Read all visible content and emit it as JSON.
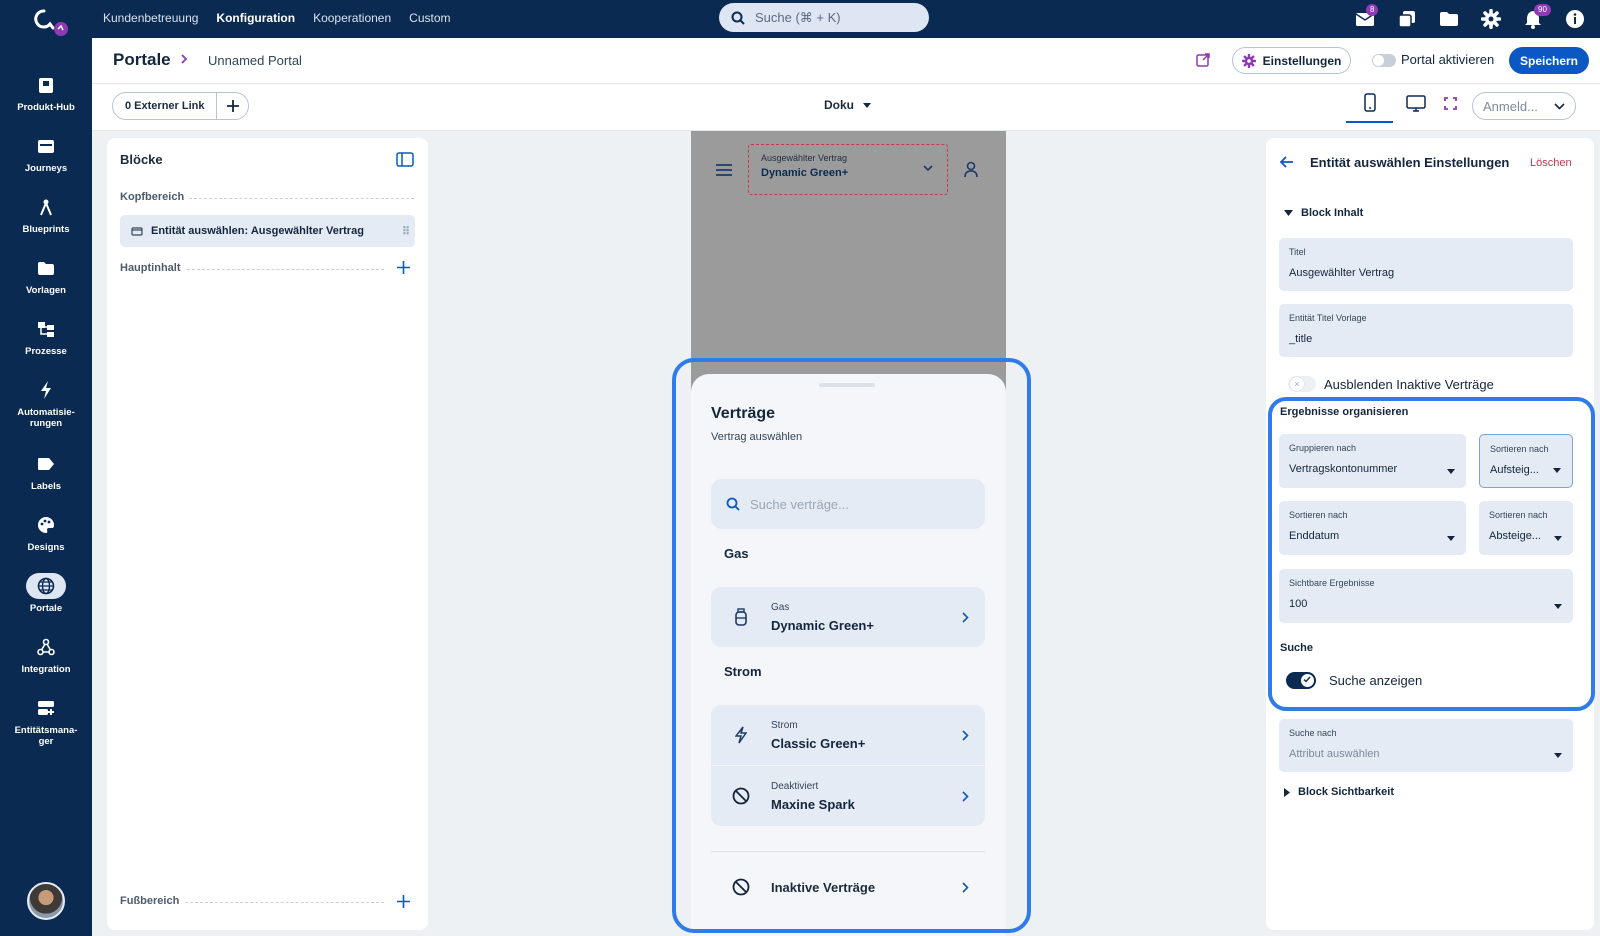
{
  "topbar": {
    "nav": [
      "Kundenbetreuung",
      "Konfiguration",
      "Kooperationen",
      "Custom"
    ],
    "active_nav": "Konfiguration",
    "search_placeholder": "Suche (⌘ + K)",
    "mail_badge": "8",
    "notification_badge": "90",
    "icons": [
      "mail-icon",
      "copy-icon",
      "folder-icon",
      "gear-icon",
      "bell-icon",
      "info-icon"
    ]
  },
  "sidebar": {
    "items": [
      {
        "label": "Produkt-Hub",
        "icon": "product-hub-icon"
      },
      {
        "label": "Journeys",
        "icon": "journeys-icon"
      },
      {
        "label": "Blueprints",
        "icon": "blueprints-icon"
      },
      {
        "label": "Vorlagen",
        "icon": "folder-icon"
      },
      {
        "label": "Prozesse",
        "icon": "processes-icon"
      },
      {
        "label": "Automatisie-\nrungen",
        "icon": "lightning-icon"
      },
      {
        "label": "Labels",
        "icon": "label-icon"
      },
      {
        "label": "Designs",
        "icon": "palette-icon"
      },
      {
        "label": "Portale",
        "icon": "globe-icon"
      },
      {
        "label": "Integration",
        "icon": "webhook-icon"
      },
      {
        "label": "Entitätsmana-\nger",
        "icon": "entity-manager-icon"
      }
    ],
    "active": "Portale"
  },
  "header": {
    "crumb_root": "Portale",
    "crumb_current": "Unnamed Portal",
    "settings_label": "Einstellungen",
    "activate_label": "Portal aktivieren",
    "save_label": "Speichern"
  },
  "toolbar": {
    "external_link_label": "0 Externer Link",
    "doku_label": "Doku",
    "login_select": "Anmeld..."
  },
  "blocks_panel": {
    "title": "Blöcke",
    "sections": {
      "head": "Kopfbereich",
      "main": "Hauptinhalt",
      "footer": "Fußbereich"
    },
    "head_item": "Entität auswählen: Ausgewählter Vertrag"
  },
  "preview": {
    "selector_title": "Ausgewählter Vertrag",
    "selector_value": "Dynamic Green+",
    "sheet_title": "Verträge",
    "sheet_subtitle": "Vertrag auswählen",
    "search_placeholder": "Suche verträge...",
    "groups": [
      {
        "title": "Gas",
        "items": [
          {
            "type": "Gas",
            "name": "Dynamic Green+",
            "icon": "gas-cylinder-icon"
          }
        ]
      },
      {
        "title": "Strom",
        "items": [
          {
            "type": "Strom",
            "name": "Classic Green+",
            "icon": "lightning-icon"
          },
          {
            "type": "Deaktiviert",
            "name": "Maxine Spark",
            "icon": "blocked-icon"
          }
        ]
      }
    ],
    "inactive_label": "Inaktive Verträge"
  },
  "settings_panel": {
    "title": "Entität auswählen Einstellungen",
    "delete_label": "Löschen",
    "block_content": "Block Inhalt",
    "title_field": {
      "label": "Titel",
      "value": "Ausgewählter Vertrag"
    },
    "template_field": {
      "label": "Entität Titel Vorlage",
      "value": "_title"
    },
    "hide_inactive_label": "Ausblenden Inaktive Verträge",
    "hide_inactive_on": false,
    "organize_title": "Ergebnisse organisieren",
    "group_by": {
      "label": "Gruppieren nach",
      "value": "Vertragskontonummer"
    },
    "sort1": {
      "label": "Sortieren nach",
      "value": "Aufsteig..."
    },
    "sort2": {
      "label": "Sortieren nach",
      "value": "Enddatum"
    },
    "sort2_dir": {
      "label": "Sortieren nach",
      "value": "Absteige..."
    },
    "visible_results": {
      "label": "Sichtbare Ergebnisse",
      "value": "100"
    },
    "search_section": "Suche",
    "show_search_label": "Suche anzeigen",
    "show_search_on": true,
    "search_by": {
      "label": "Suche nach",
      "placeholder": "Attribut auswählen"
    },
    "block_visibility": "Block Sichtbarkeit"
  },
  "colors": {
    "navy": "#0a2a52",
    "primary": "#0b58c4",
    "highlight": "#2f7bea",
    "danger": "#c6364f"
  }
}
